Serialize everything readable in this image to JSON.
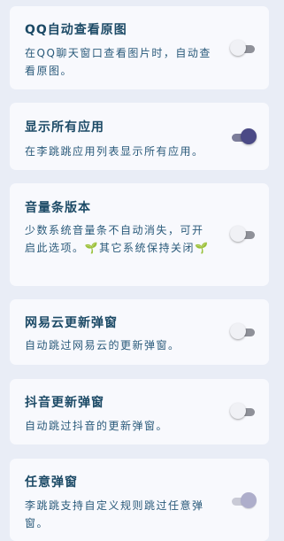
{
  "settings": [
    {
      "title": "QQ自动查看原图",
      "desc": "在QQ聊天窗口查看图片时，自动查看原图。",
      "toggle": "off"
    },
    {
      "title": "显示所有应用",
      "desc": "在李跳跳应用列表显示所有应用。",
      "toggle": "on"
    },
    {
      "title": "音量条版本",
      "desc": "少数系统音量条不自动消失，可开启此选项。🌱其它系统保持关闭🌱",
      "toggle": "off"
    },
    {
      "title": "网易云更新弹窗",
      "desc": "自动跳过网易云的更新弹窗。",
      "toggle": "off"
    },
    {
      "title": "抖音更新弹窗",
      "desc": "自动跳过抖音的更新弹窗。",
      "toggle": "off"
    },
    {
      "title": "任意弹窗",
      "desc": "李跳跳支持自定义规则跳过任意弹窗。",
      "toggle": "on-disabled"
    }
  ],
  "colors": {
    "background": "#e9edf6",
    "card": "#f8f9fd",
    "title": "#1c4a66",
    "description": "#2a5a7a",
    "toggle_on": "#4b4a86",
    "toggle_off_track": "#8f9199"
  }
}
